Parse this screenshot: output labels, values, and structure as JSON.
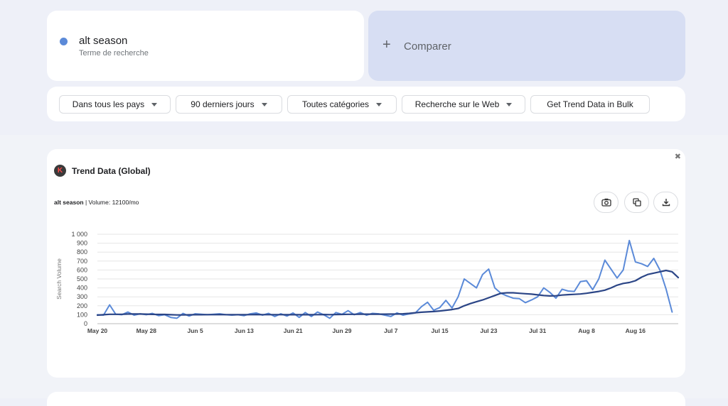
{
  "search": {
    "term": "alt season",
    "term_caption": "Terme de recherche",
    "compare_plus": "+",
    "compare_label": "Comparer",
    "term_color": "#5b8ad8"
  },
  "filters": [
    {
      "label": "Dans tous les pays",
      "dropdown": true
    },
    {
      "label": "90 derniers jours",
      "dropdown": true
    },
    {
      "label": "Toutes catégories",
      "dropdown": true
    },
    {
      "label": "Recherche sur le Web",
      "dropdown": true
    },
    {
      "label": "Get Trend Data in Bulk",
      "dropdown": false
    }
  ],
  "panel": {
    "close": "✖",
    "logo_letter": "K",
    "title": "Trend Data (Global)",
    "keyword": "alt season",
    "volume_text": " | Volume: 12100/mo",
    "icons": [
      "camera-icon",
      "copy-icon",
      "download-icon"
    ]
  },
  "chart_data": {
    "type": "line",
    "ylabel": "Search Volume",
    "ylim": [
      0,
      1000
    ],
    "yticks": [
      "0",
      "100",
      "200",
      "300",
      "400",
      "500",
      "600",
      "700",
      "800",
      "900",
      "1 000"
    ],
    "xtick_labels": [
      "May 20",
      "May 28",
      "Jun 5",
      "Jun 13",
      "Jun 21",
      "Jun 29",
      "Jul 7",
      "Jul 15",
      "Jul 23",
      "Jul 31",
      "Aug 8",
      "Aug 16"
    ],
    "xtick_index": [
      0,
      8,
      16,
      24,
      32,
      40,
      48,
      56,
      64,
      72,
      80,
      88
    ],
    "grid": true,
    "series": [
      {
        "color": "#5b8ad8",
        "values": [
          100,
          95,
          210,
          105,
          100,
          130,
          95,
          110,
          100,
          115,
          90,
          100,
          70,
          60,
          115,
          85,
          110,
          105,
          100,
          105,
          110,
          100,
          95,
          100,
          90,
          110,
          120,
          95,
          115,
          80,
          110,
          85,
          120,
          70,
          125,
          80,
          130,
          100,
          60,
          125,
          105,
          145,
          100,
          125,
          95,
          115,
          110,
          95,
          80,
          120,
          95,
          110,
          120,
          190,
          240,
          150,
          180,
          260,
          175,
          300,
          500,
          450,
          400,
          550,
          610,
          400,
          340,
          310,
          285,
          280,
          235,
          265,
          300,
          400,
          350,
          285,
          385,
          365,
          360,
          470,
          480,
          380,
          500,
          710,
          610,
          510,
          600,
          930,
          690,
          670,
          640,
          730,
          600,
          390,
          130
        ]
      },
      {
        "color": "#2b4586",
        "values": [
          95,
          100,
          105,
          105,
          105,
          108,
          108,
          108,
          106,
          104,
          103,
          103,
          100,
          98,
          98,
          99,
          100,
          100,
          101,
          101,
          102,
          101,
          100,
          100,
          100,
          101,
          102,
          101,
          101,
          101,
          101,
          100,
          101,
          100,
          101,
          100,
          101,
          102,
          101,
          102,
          103,
          105,
          105,
          106,
          106,
          106,
          106,
          106,
          107,
          108,
          110,
          115,
          122,
          128,
          132,
          136,
          142,
          150,
          158,
          170,
          200,
          225,
          245,
          265,
          290,
          315,
          340,
          345,
          345,
          340,
          335,
          330,
          322,
          315,
          310,
          312,
          320,
          325,
          328,
          332,
          340,
          350,
          360,
          375,
          400,
          430,
          450,
          460,
          480,
          520,
          550,
          565,
          580,
          595,
          580,
          515
        ]
      }
    ]
  }
}
